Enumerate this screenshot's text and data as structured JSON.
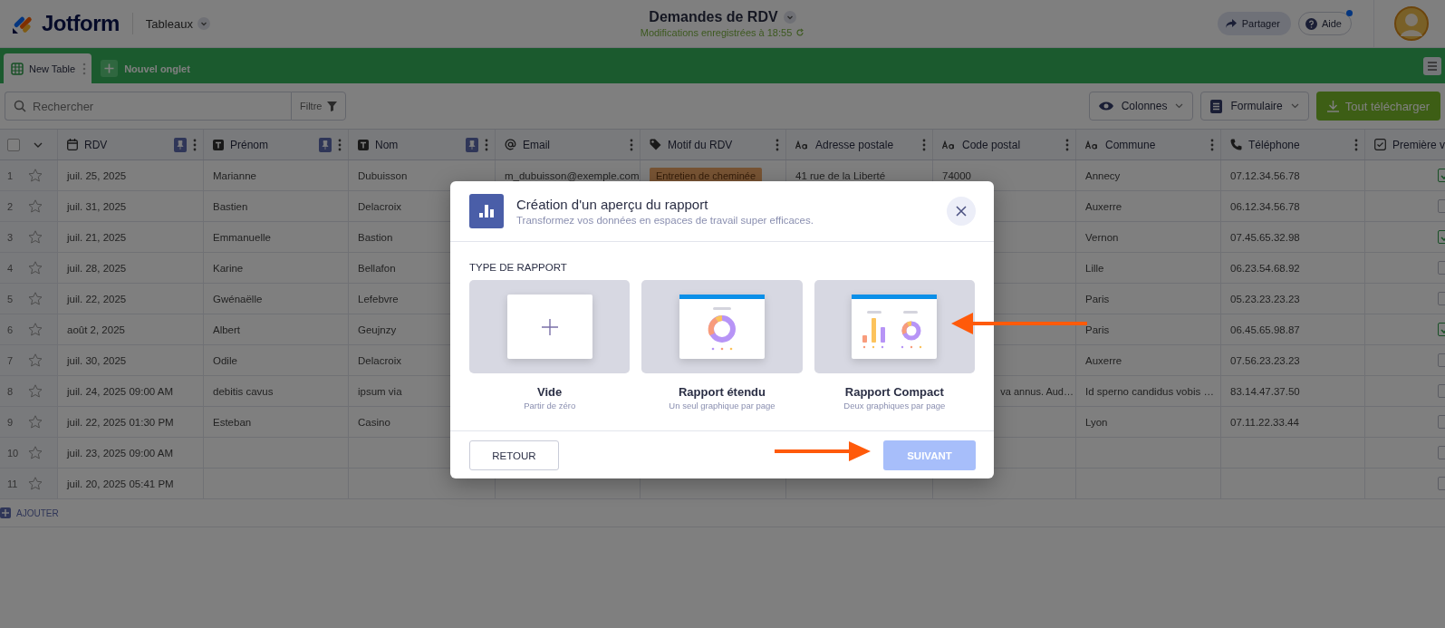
{
  "header": {
    "logo": "Jotform",
    "workspace": "Tableaux",
    "title": "Demandes de RDV",
    "saved": "Modifications enregistrées à 18:55",
    "share": "Partager",
    "help": "Aide",
    "help_notification": true
  },
  "tabs": [
    {
      "label": "New Table",
      "selected": true
    }
  ],
  "add_tab": "Nouvel onglet",
  "toolbar": {
    "search_placeholder": "Rechercher",
    "filter": "Filtre",
    "columns_button": "Colonnes",
    "form_button": "Formulaire",
    "download_button": "Tout télécharger"
  },
  "columns": [
    {
      "label": "RDV",
      "kind": "date",
      "pinned": true
    },
    {
      "label": "Prénom",
      "kind": "text",
      "pinned": true
    },
    {
      "label": "Nom",
      "kind": "text",
      "pinned": true
    },
    {
      "label": "Email",
      "kind": "email",
      "pinned": false
    },
    {
      "label": "Motif du RDV",
      "kind": "tag",
      "pinned": false
    },
    {
      "label": "Adresse postale",
      "kind": "short",
      "pinned": false
    },
    {
      "label": "Code postal",
      "kind": "short",
      "pinned": false
    },
    {
      "label": "Commune",
      "kind": "short",
      "pinned": false
    },
    {
      "label": "Téléphone",
      "kind": "phone",
      "pinned": false
    },
    {
      "label": "Première v",
      "kind": "check",
      "pinned": false
    }
  ],
  "select_all_checked": false,
  "rows": [
    {
      "num": "1",
      "starred": false,
      "checked": true,
      "cells": [
        "juil. 25, 2025",
        "Marianne",
        "Dubuisson",
        "m_dubuisson@exemple.com",
        {
          "kind": "tag",
          "text": "Entretien de cheminée"
        },
        "41 rue de la Liberté",
        "74000",
        "Annecy",
        "07.12.34.56.78"
      ]
    },
    {
      "num": "2",
      "starred": false,
      "checked": false,
      "cells": [
        "juil. 31, 2025",
        "Bastien",
        "Delacroix",
        null,
        null,
        null,
        null,
        "Auxerre",
        "06.12.34.56.78"
      ]
    },
    {
      "num": "3",
      "starred": false,
      "checked": true,
      "cells": [
        "juil. 21, 2025",
        "Emmanuelle",
        "Bastion",
        null,
        null,
        null,
        null,
        "Vernon",
        "07.45.65.32.98"
      ]
    },
    {
      "num": "4",
      "starred": false,
      "checked": false,
      "cells": [
        "juil. 28, 2025",
        "Karine",
        "Bellafon",
        null,
        null,
        null,
        null,
        "Lille",
        "06.23.54.68.92"
      ]
    },
    {
      "num": "5",
      "starred": false,
      "checked": false,
      "cells": [
        "juil. 22, 2025",
        "Gwénaëlle",
        "Lefebvre",
        null,
        null,
        null,
        null,
        "Paris",
        "05.23.23.23.23"
      ]
    },
    {
      "num": "6",
      "starred": false,
      "checked": true,
      "cells": [
        "août 2, 2025",
        "Albert",
        "Geujnzy",
        null,
        null,
        null,
        null,
        "Paris",
        "06.45.65.98.87"
      ]
    },
    {
      "num": "7",
      "starred": false,
      "checked": false,
      "cells": [
        "juil. 30, 2025",
        "Odile",
        "Delacroix",
        null,
        null,
        null,
        null,
        "Auxerre",
        "07.56.23.23.23"
      ]
    },
    {
      "num": "8",
      "starred": false,
      "checked": false,
      "cells": [
        "juil. 24, 2025 09:00 AM",
        "debitis cavus",
        "ipsum via",
        null,
        null,
        null,
        {
          "kind": "covered",
          "text": "va annus. Aud…"
        },
        "Id sperno candidus vobis …",
        "83.14.47.37.50"
      ]
    },
    {
      "num": "9",
      "starred": false,
      "checked": false,
      "cells": [
        "juil. 22, 2025 01:30 PM",
        "Esteban",
        "Casino",
        null,
        null,
        null,
        null,
        "Lyon",
        "07.11.22.33.44"
      ]
    },
    {
      "num": "10",
      "starred": false,
      "checked": false,
      "cells": [
        "juil. 23, 2025 09:00 AM",
        null,
        null,
        null,
        null,
        null,
        null,
        null,
        null
      ]
    },
    {
      "num": "11",
      "starred": false,
      "checked": false,
      "cells": [
        "juil. 20, 2025 05:41 PM",
        null,
        null,
        null,
        null,
        null,
        null,
        null,
        null
      ]
    }
  ],
  "add_row": "AJOUTER",
  "dialog": {
    "title": "Création d'un aperçu du rapport",
    "subtitle": "Transformez vos données en espaces de travail super efficaces.",
    "section": "TYPE DE RAPPORT",
    "options": [
      {
        "kind": "blank",
        "title": "Vide",
        "subtitle": "Partir de zéro",
        "selected": false
      },
      {
        "kind": "wide",
        "title": "Rapport étendu",
        "subtitle": "Un seul graphique par page",
        "selected": false
      },
      {
        "kind": "compact",
        "title": "Rapport Compact",
        "subtitle": "Deux graphiques par page",
        "selected": false
      }
    ],
    "back": "RETOUR",
    "next": "SUIVANT",
    "next_disabled": true
  }
}
